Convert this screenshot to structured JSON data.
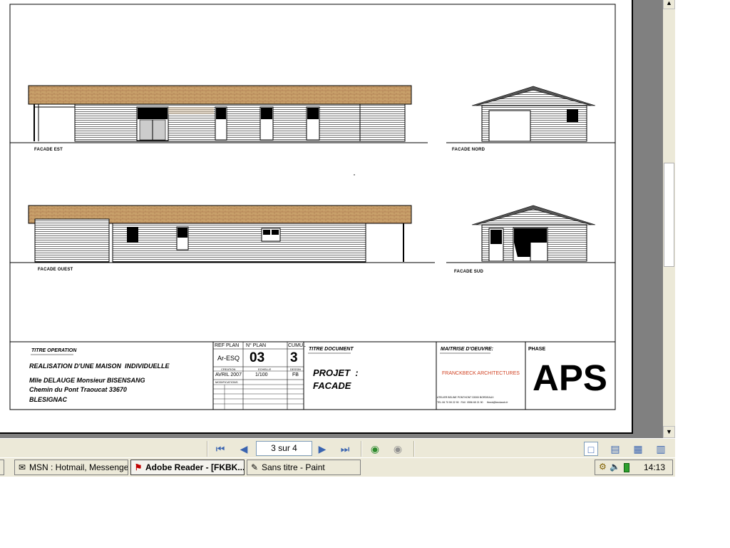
{
  "drawing": {
    "facade_labels": {
      "est": "FACADE EST",
      "nord": "FACADE NORD",
      "ouest": "FACADE OUEST",
      "sud": "FACADE SUD"
    }
  },
  "title_block": {
    "titre_operation_label": "TITRE OPERATION",
    "operation": "REALISATION D'UNE MAISON  INDIVIDUELLE",
    "client": "Mlle DELAUGE Monsieur BISENSANG",
    "address": "Chemin du Pont Traoucat 33670",
    "city": "BLESIGNAC",
    "ref_plan_label": "REF PLAN",
    "ref_plan": "Ar-ESQ",
    "n_plan_label": "N° PLAN",
    "n_plan": "03",
    "cumul_label": "CUMUL",
    "cumul": "3",
    "creation_label": "CREATION",
    "creation_date": "AVRIL 2007",
    "echelle_label": "ECHELLE",
    "echelle": "1/100",
    "dessin_label": "DESSIN",
    "dessin": "FB",
    "modifications_label": "MODIFICATIONS",
    "titre_document_label": "TITRE DOCUMENT",
    "projet": "PROJET  :",
    "facade": "FACADE",
    "maitrise_label": "MAITRISE D'OEUVRE:",
    "architect": "FRANCKBECK ARCHITECTURES",
    "atelier": "ATELIER BELINE PONTHONT  33300 BORDEAUX",
    "contact": "TEL 06 70 59 22 90   FAX  0556 65 21 90      fbeck@beckarch.fr",
    "phase_label": "PHASE",
    "phase": "APS"
  },
  "navigation": {
    "page_indicator": "3 sur 4"
  },
  "taskbar": {
    "tasks": [
      {
        "label": "MSN : Hotmail, Messenge...",
        "icon": "msn-icon"
      },
      {
        "label": "Adobe Reader - [FKBK...",
        "icon": "adobe-reader-icon"
      },
      {
        "label": "Sans titre - Paint",
        "icon": "paint-icon"
      }
    ],
    "clock": "14:13"
  },
  "colors": {
    "roof": "#c8a06a",
    "roof_stripe": "#b8895a",
    "workspace": "#808080",
    "toolbar": "#ece9d8",
    "architect_red": "#d04020"
  }
}
